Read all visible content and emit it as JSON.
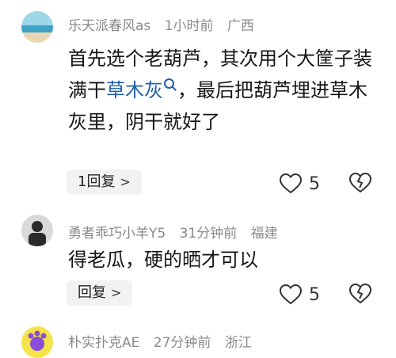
{
  "comments": [
    {
      "username": "乐天派春风as",
      "time": "1小时前",
      "location": "广西",
      "text_before": "首先选个老葫芦，其次用个大筐子装满干",
      "link_text": "草木灰",
      "text_after": "，最后把葫芦埋进草木灰里，阴干就好了",
      "reply_label": "1回复",
      "likes": "5",
      "colors": {
        "avatar_sky": "#9fd6e8",
        "avatar_sea": "#3fa3c8",
        "avatar_sand": "#e9d7b4"
      }
    },
    {
      "username": "勇者乖巧小羊Y5",
      "time": "31分钟前",
      "location": "福建",
      "text": "得老瓜，硬的晒才可以",
      "reply_label": "回复",
      "likes": "5",
      "colors": {
        "avatar_bg": "#d9d9d9",
        "avatar_fg": "#2a2a2a"
      }
    },
    {
      "username": "朴实扑克AE",
      "time": "27分钟前",
      "location": "浙江",
      "colors": {
        "avatar_bg": "#f6e24a",
        "avatar_fg": "#8a4dd8"
      }
    }
  ],
  "icons": {
    "like": "heart-outline-icon",
    "dislike": "broken-heart-icon",
    "reply_arrow": "chevron-right-icon",
    "search": "search-icon"
  }
}
